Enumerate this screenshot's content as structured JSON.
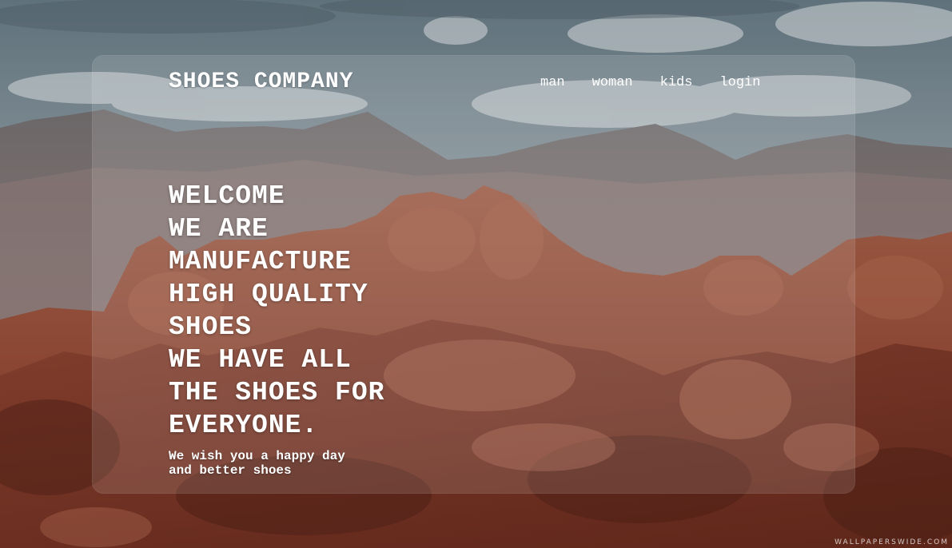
{
  "colors": {
    "sky": "#7b8b94",
    "cloud": "#c9cfd2",
    "mountain_far": "#6f6a6b",
    "mountain_mid": "#7d6660",
    "rock": "#8a4a36",
    "rock_dark": "#5e2b1f",
    "text": "#ffffff"
  },
  "header": {
    "brand": "SHOES COMPANY",
    "nav": [
      "man",
      "woman",
      "kids",
      "login"
    ]
  },
  "hero": {
    "lines": [
      "WELCOME",
      "WE ARE",
      "MANUFACTURE",
      "HIGH QUALITY",
      "SHOES",
      "WE HAVE ALL",
      "THE SHOES FOR",
      "EVERYONE."
    ],
    "tagline": [
      "We wish you a happy day",
      "and better shoes"
    ]
  },
  "background": {
    "watermark": "WALLPAPERSWIDE.COM"
  }
}
